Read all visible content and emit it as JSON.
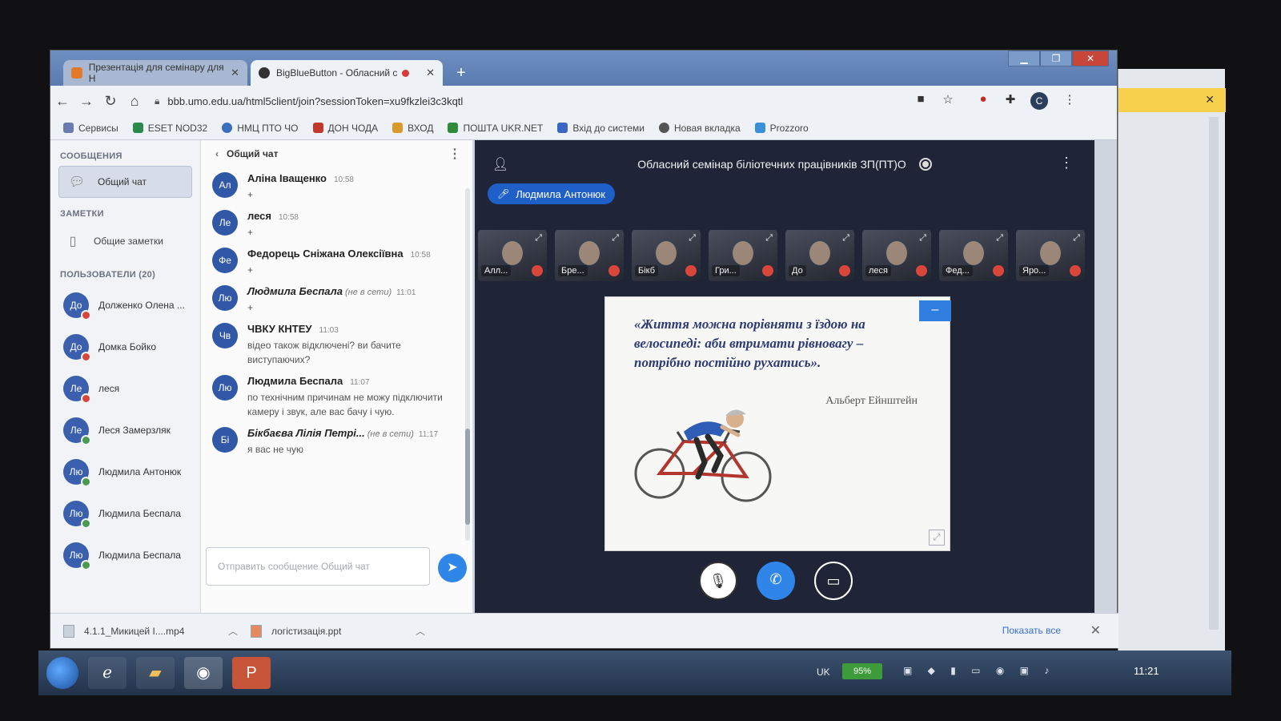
{
  "browser": {
    "tabs": [
      {
        "label": "Презентація для семінару для Н",
        "active": false
      },
      {
        "label": "BigBlueButton - Обласний с",
        "active": true
      }
    ],
    "new_tab": "+",
    "url": "bbb.umo.edu.ua/html5client/join?sessionToken=xu9fkzlei3c3kqtl",
    "profile_initial": "C",
    "bookmarks": [
      "Сервисы",
      "ESET NOD32",
      "НМЦ ПТО ЧО",
      "ДОН ЧОДА",
      "ВХОД",
      "ПОШТА UKR.NET",
      "Вхід до системи",
      "Новая вкладка",
      "Prozzoro"
    ]
  },
  "sidebar": {
    "messages_title": "СООБЩЕНИЯ",
    "public_chat": "Общий чат",
    "notes_title": "ЗАМЕТКИ",
    "shared_notes": "Общие заметки",
    "users_title": "ПОЛЬЗОВАТЕЛИ (20)",
    "users": [
      {
        "initials": "До",
        "name": "Долженко Олена ...",
        "status": "red"
      },
      {
        "initials": "До",
        "name": "Домка Бойко",
        "status": "red"
      },
      {
        "initials": "Ле",
        "name": "леся",
        "status": "red"
      },
      {
        "initials": "Ле",
        "name": "Леся Замерзляк",
        "status": "green"
      },
      {
        "initials": "Лю",
        "name": "Людмила Антонюк",
        "status": "green"
      },
      {
        "initials": "Лю",
        "name": "Людмила Беспала",
        "status": "green"
      },
      {
        "initials": "Лю",
        "name": "Людмила Беспала",
        "status": "green"
      }
    ]
  },
  "chat": {
    "title": "Общий чат",
    "messages": [
      {
        "initials": "Ал",
        "name": "Аліна Іващенко",
        "time": "10:58",
        "offline": "",
        "text": "+"
      },
      {
        "initials": "Ле",
        "name": "леся",
        "time": "10:58",
        "offline": "",
        "text": "+"
      },
      {
        "initials": "Фе",
        "name": "Федорець Сніжана Олексіївна",
        "time": "10:58",
        "offline": "",
        "text": "+"
      },
      {
        "initials": "Лю",
        "name": "Людмила Беспала",
        "time": "11:01",
        "offline": "(не в сети)",
        "text": "+"
      },
      {
        "initials": "Чв",
        "name": "ЧВКУ КНТЕУ",
        "time": "11:03",
        "offline": "",
        "text": "відео також відключені? ви бачите виступаючих?"
      },
      {
        "initials": "Лю",
        "name": "Людмила Беспала",
        "time": "11:07",
        "offline": "",
        "text": "по технічним причинам не можу підключити камеру і звук, але вас бачу і чую."
      },
      {
        "initials": "Бі",
        "name": "Бікбаєва Лілія Петрі...",
        "time": "11:17",
        "offline": "(не в сети)",
        "text": "я вас не чую"
      }
    ],
    "input_placeholder": "Отправить сообщение Общий чат"
  },
  "stage": {
    "meeting_title": "Обласний семінар біліотечних працівників ЗП(ПТ)О",
    "talking": "Людмила Антонюк",
    "tiles": [
      "Алл...",
      "Бре...",
      "Бікб",
      "Гри...",
      "До",
      "леся",
      "Фед...",
      "Яро..."
    ],
    "slide": {
      "quote": "«Життя можна порівняти з їздою на велосипеді: аби втримати рівновагу – потрібно постійно рухатись».",
      "author": "Альберт Ейнштейн"
    },
    "minimize": "–"
  },
  "downloads": {
    "files": [
      "4.1.1_Микицей І....mp4",
      "логістизація.ppt"
    ],
    "show_all": "Показать все"
  },
  "taskbar": {
    "language": "UK",
    "battery": "95%",
    "clock": "11:21"
  },
  "colors": {
    "accent_blue": "#2f86e8",
    "stage_bg": "#1f2437",
    "status_red": "#d9463a",
    "status_green": "#4b9a52"
  }
}
